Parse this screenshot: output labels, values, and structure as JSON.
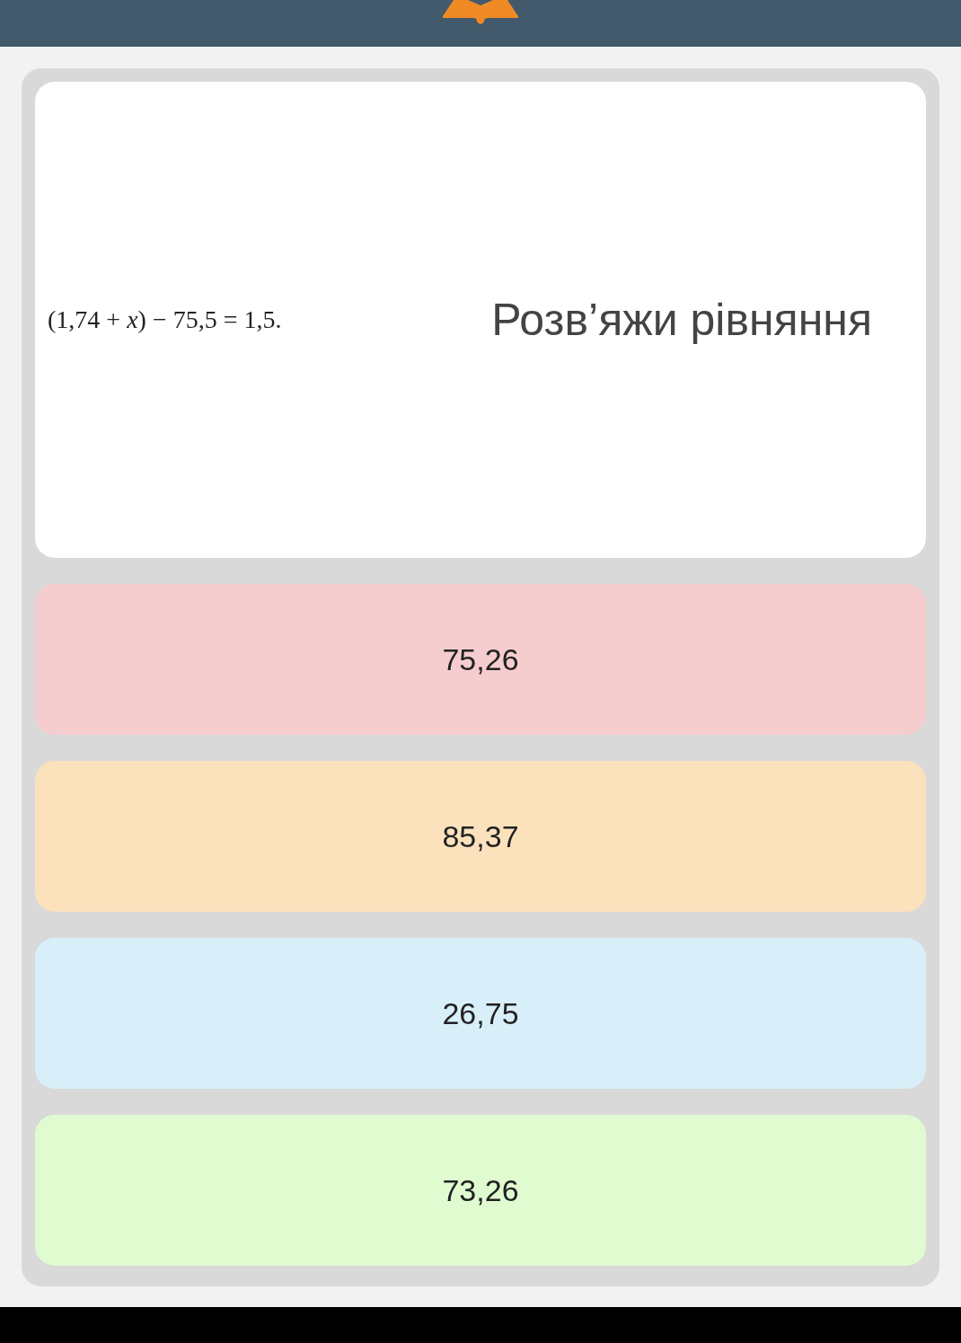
{
  "question": {
    "equation": "(1,74 + *x*) − 75,5 = 1,5.",
    "title": "Розв’яжи рівняння"
  },
  "answers": [
    {
      "text": "75,26",
      "color": "#f6cdcf"
    },
    {
      "text": "85,37",
      "color": "#fbe2bd"
    },
    {
      "text": "26,75",
      "color": "#d8eff9"
    },
    {
      "text": "73,26",
      "color": "#e0fbd0"
    }
  ]
}
